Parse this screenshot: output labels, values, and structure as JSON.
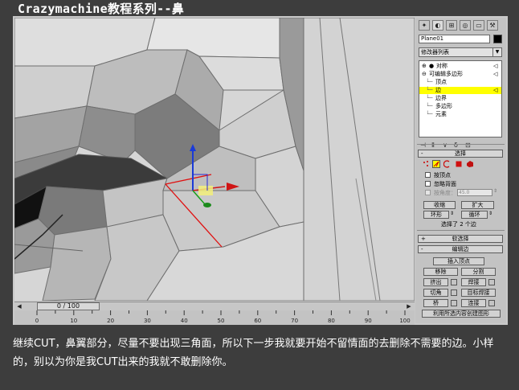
{
  "title": "Crazymachine教程系列--鼻",
  "timeline": {
    "slider_label": "0 / 100",
    "ticks": [
      "0",
      "10",
      "20",
      "30",
      "40",
      "50",
      "60",
      "70",
      "80",
      "90",
      "100"
    ]
  },
  "panel": {
    "tabs": [
      "create-icon",
      "modify-icon",
      "hierarchy-icon",
      "motion-icon",
      "display-icon",
      "utilities-icon"
    ],
    "object_name": "Plane01",
    "object_color": "#000000",
    "modifier_list": "修改器列表",
    "stack": [
      {
        "label": "对称",
        "level": 0
      },
      {
        "label": "可编辑多边形",
        "level": 0
      },
      {
        "label": "顶点",
        "level": 1
      },
      {
        "label": "边",
        "level": 1
      },
      {
        "label": "边界",
        "level": 1
      },
      {
        "label": "多边形",
        "level": 1
      },
      {
        "label": "元素",
        "level": 1
      }
    ],
    "selected_stack_item": "边",
    "highlight_color": "#ffff00",
    "selection": {
      "header": "选择",
      "by_vertex": "按顶点",
      "ignore_backfacing": "忽略背面",
      "by_angle": "按角度：",
      "angle_value": "45.0",
      "shrink": "收缩",
      "grow": "扩大",
      "ring": "环形",
      "loop": "循环",
      "status": "选择了 2 个边"
    },
    "soft_selection": "软选择",
    "edit_edges": {
      "header": "编辑边",
      "insert_vertex": "插入顶点",
      "remove": "移除",
      "split": "分割",
      "extrude": "挤出",
      "weld": "焊接",
      "chamfer": "切角",
      "target_weld": "目标焊接",
      "bridge": "桥",
      "connect": "连接",
      "create_shape": "利用所选内容创建图形"
    }
  },
  "caption": "继续CUT，鼻翼部分，尽量不要出现三角面，所以下一步我就要开始不留情面的去删除不需要的边。小样的，别以为你是我CUT出来的我就不敢删除你。"
}
